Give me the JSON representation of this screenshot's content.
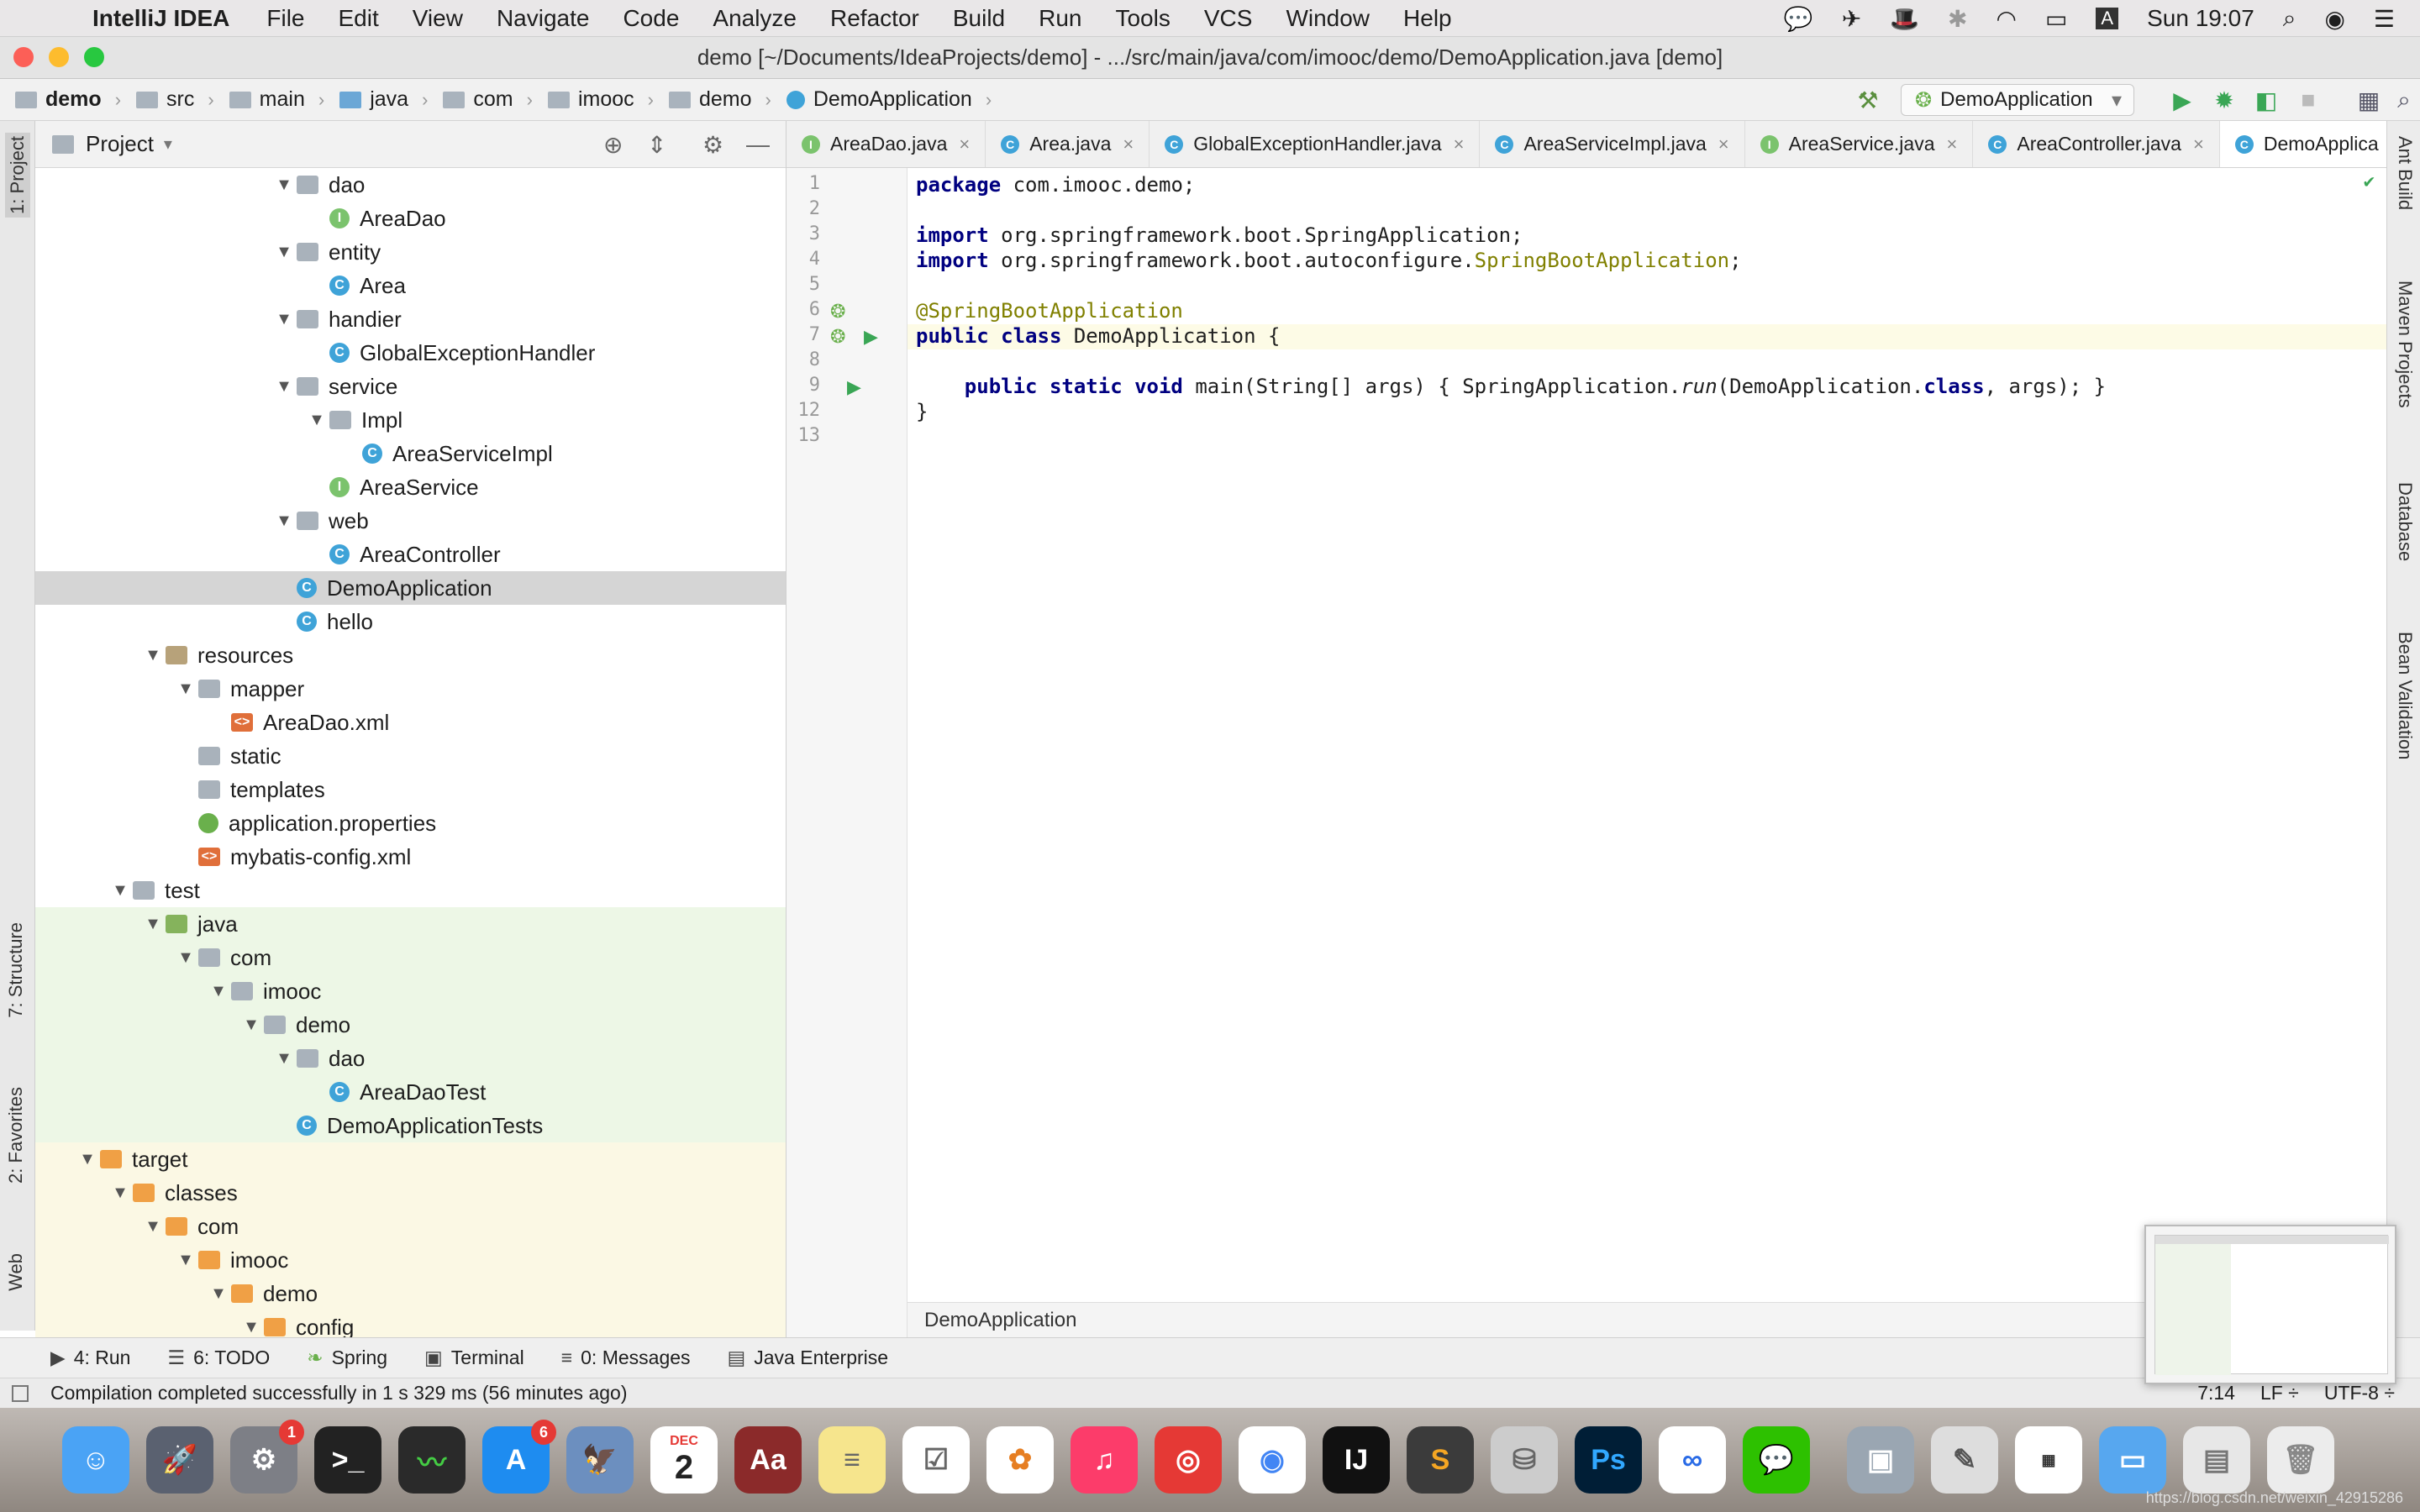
{
  "menubar": {
    "app_name": "IntelliJ IDEA",
    "items": [
      "File",
      "Edit",
      "View",
      "Navigate",
      "Code",
      "Analyze",
      "Refactor",
      "Build",
      "Run",
      "Tools",
      "VCS",
      "Window",
      "Help"
    ],
    "clock": "Sun 19:07"
  },
  "window": {
    "title": "demo [~/Documents/IdeaProjects/demo] - .../src/main/java/com/imooc/demo/DemoApplication.java [demo]"
  },
  "breadcrumbs": [
    "demo",
    "src",
    "main",
    "java",
    "com",
    "imooc",
    "demo",
    "DemoApplication"
  ],
  "run_config": "DemoApplication",
  "project_panel": {
    "title": "Project",
    "tree": [
      {
        "label": "dao",
        "icon": "folder-icon",
        "depth": 7,
        "arrow": "expanded"
      },
      {
        "label": "AreaDao",
        "icon": "interface-icon",
        "depth": 8,
        "arrow": "none"
      },
      {
        "label": "entity",
        "icon": "folder-icon",
        "depth": 7,
        "arrow": "expanded"
      },
      {
        "label": "Area",
        "icon": "class-icon",
        "depth": 8,
        "arrow": "none"
      },
      {
        "label": "handier",
        "icon": "folder-icon",
        "depth": 7,
        "arrow": "expanded"
      },
      {
        "label": "GlobalExceptionHandler",
        "icon": "class-icon",
        "depth": 8,
        "arrow": "none"
      },
      {
        "label": "service",
        "icon": "folder-icon",
        "depth": 7,
        "arrow": "expanded"
      },
      {
        "label": "Impl",
        "icon": "folder-icon",
        "depth": 8,
        "arrow": "expanded"
      },
      {
        "label": "AreaServiceImpl",
        "icon": "class-icon",
        "depth": 9,
        "arrow": "none"
      },
      {
        "label": "AreaService",
        "icon": "interface-icon",
        "depth": 8,
        "arrow": "none"
      },
      {
        "label": "web",
        "icon": "folder-icon",
        "depth": 7,
        "arrow": "expanded"
      },
      {
        "label": "AreaController",
        "icon": "class-icon",
        "depth": 8,
        "arrow": "none"
      },
      {
        "label": "DemoApplication",
        "icon": "spring-boot-class-icon",
        "depth": 7,
        "arrow": "none",
        "selected": true
      },
      {
        "label": "hello",
        "icon": "class-icon",
        "depth": 7,
        "arrow": "none"
      },
      {
        "label": "resources",
        "icon": "resources-folder-icon",
        "depth": 3,
        "arrow": "expanded"
      },
      {
        "label": "mapper",
        "icon": "folder-icon",
        "depth": 4,
        "arrow": "expanded"
      },
      {
        "label": "AreaDao.xml",
        "icon": "xml-file-icon",
        "depth": 5,
        "arrow": "none"
      },
      {
        "label": "static",
        "icon": "folder-icon",
        "depth": 4,
        "arrow": "none"
      },
      {
        "label": "templates",
        "icon": "folder-icon",
        "depth": 4,
        "arrow": "none"
      },
      {
        "label": "application.properties",
        "icon": "properties-file-icon",
        "depth": 4,
        "arrow": "none"
      },
      {
        "label": "mybatis-config.xml",
        "icon": "xml-file-icon",
        "depth": 4,
        "arrow": "none"
      },
      {
        "label": "test",
        "icon": "folder-icon",
        "depth": 2,
        "arrow": "expanded"
      },
      {
        "label": "java",
        "icon": "test-folder-icon",
        "depth": 3,
        "arrow": "expanded",
        "zone": "test"
      },
      {
        "label": "com",
        "icon": "folder-icon",
        "depth": 4,
        "arrow": "expanded",
        "zone": "test"
      },
      {
        "label": "imooc",
        "icon": "folder-icon",
        "depth": 5,
        "arrow": "expanded",
        "zone": "test"
      },
      {
        "label": "demo",
        "icon": "folder-icon",
        "depth": 6,
        "arrow": "expanded",
        "zone": "test"
      },
      {
        "label": "dao",
        "icon": "folder-icon",
        "depth": 7,
        "arrow": "expanded",
        "zone": "test"
      },
      {
        "label": "AreaDaoTest",
        "icon": "test-class-icon",
        "depth": 8,
        "arrow": "none",
        "zone": "test"
      },
      {
        "label": "DemoApplicationTests",
        "icon": "test-class-icon",
        "depth": 7,
        "arrow": "none",
        "zone": "test"
      },
      {
        "label": "target",
        "icon": "orange-folder-icon",
        "depth": 1,
        "arrow": "expanded",
        "zone": "target"
      },
      {
        "label": "classes",
        "icon": "orange-folder-icon",
        "depth": 2,
        "arrow": "expanded",
        "zone": "target"
      },
      {
        "label": "com",
        "icon": "orange-folder-icon",
        "depth": 3,
        "arrow": "expanded",
        "zone": "target"
      },
      {
        "label": "imooc",
        "icon": "orange-folder-icon",
        "depth": 4,
        "arrow": "expanded",
        "zone": "target"
      },
      {
        "label": "demo",
        "icon": "orange-folder-icon",
        "depth": 5,
        "arrow": "expanded",
        "zone": "target"
      },
      {
        "label": "config",
        "icon": "orange-folder-icon",
        "depth": 6,
        "arrow": "expanded",
        "zone": "target"
      }
    ]
  },
  "editor": {
    "tabs": [
      {
        "label": "AreaDao.java",
        "kind": "I"
      },
      {
        "label": "Area.java",
        "kind": "C"
      },
      {
        "label": "GlobalExceptionHandler.java",
        "kind": "C"
      },
      {
        "label": "AreaServiceImpl.java",
        "kind": "C"
      },
      {
        "label": "AreaService.java",
        "kind": "I"
      },
      {
        "label": "AreaController.java",
        "kind": "C"
      },
      {
        "label": "DemoApplica",
        "kind": "C",
        "active": true
      }
    ],
    "line_numbers": [
      "1",
      "2",
      "3",
      "4",
      "5",
      "6",
      "7",
      "8",
      "9",
      "12",
      "13"
    ],
    "code": {
      "l1_kw": "package",
      "l1_rest": " com.imooc.demo;",
      "l3_kw": "import",
      "l3_rest": " org.springframework.boot.SpringApplication;",
      "l4_kw": "import",
      "l4_rest": " org.springframework.boot.autoconfigure.",
      "l4_ann": "SpringBootApplication",
      "l4_end": ";",
      "l6_ann": "@SpringBootApplication",
      "l7_kw": "public class",
      "l7_rest": " DemoApplication {",
      "l9_kw": "    public static void",
      "l9_a": " main(String[] args) { SpringApplication.",
      "l9_it": "run",
      "l9_b": "(DemoApplication.",
      "l9_kw2": "class",
      "l9_c": ", args); }",
      "l12": "}"
    },
    "breadcrumb": "DemoApplication"
  },
  "side_tools_left": [
    "1: Project",
    "7: Structure",
    "2: Favorites",
    "Web"
  ],
  "side_tools_right": [
    "Ant Build",
    "Maven Projects",
    "Database",
    "Bean Validation"
  ],
  "bottom_tools": [
    {
      "label": "4: Run"
    },
    {
      "label": "6: TODO"
    },
    {
      "label": "Spring"
    },
    {
      "label": "Terminal"
    },
    {
      "label": "0: Messages"
    },
    {
      "label": "Java Enterprise"
    }
  ],
  "status": {
    "message": "Compilation completed successfully in 1 s 329 ms (56 minutes ago)",
    "position": "7:14",
    "line_sep": "LF ÷",
    "encoding": "UTF-8 ÷"
  },
  "dock": {
    "calendar_month": "DEC",
    "calendar_day": "2",
    "app_store_badge": "6",
    "prefs_badge": "1",
    "dict_label": "Aa",
    "ps_label": "Ps"
  },
  "watermark": "https://blog.csdn.net/weixin_42915286",
  "colors": {
    "keyword": "#000080",
    "annotation": "#808000",
    "selection": "#d5d5d5",
    "test_zone": "#edf7e6",
    "target_zone": "#fbf8e4"
  }
}
